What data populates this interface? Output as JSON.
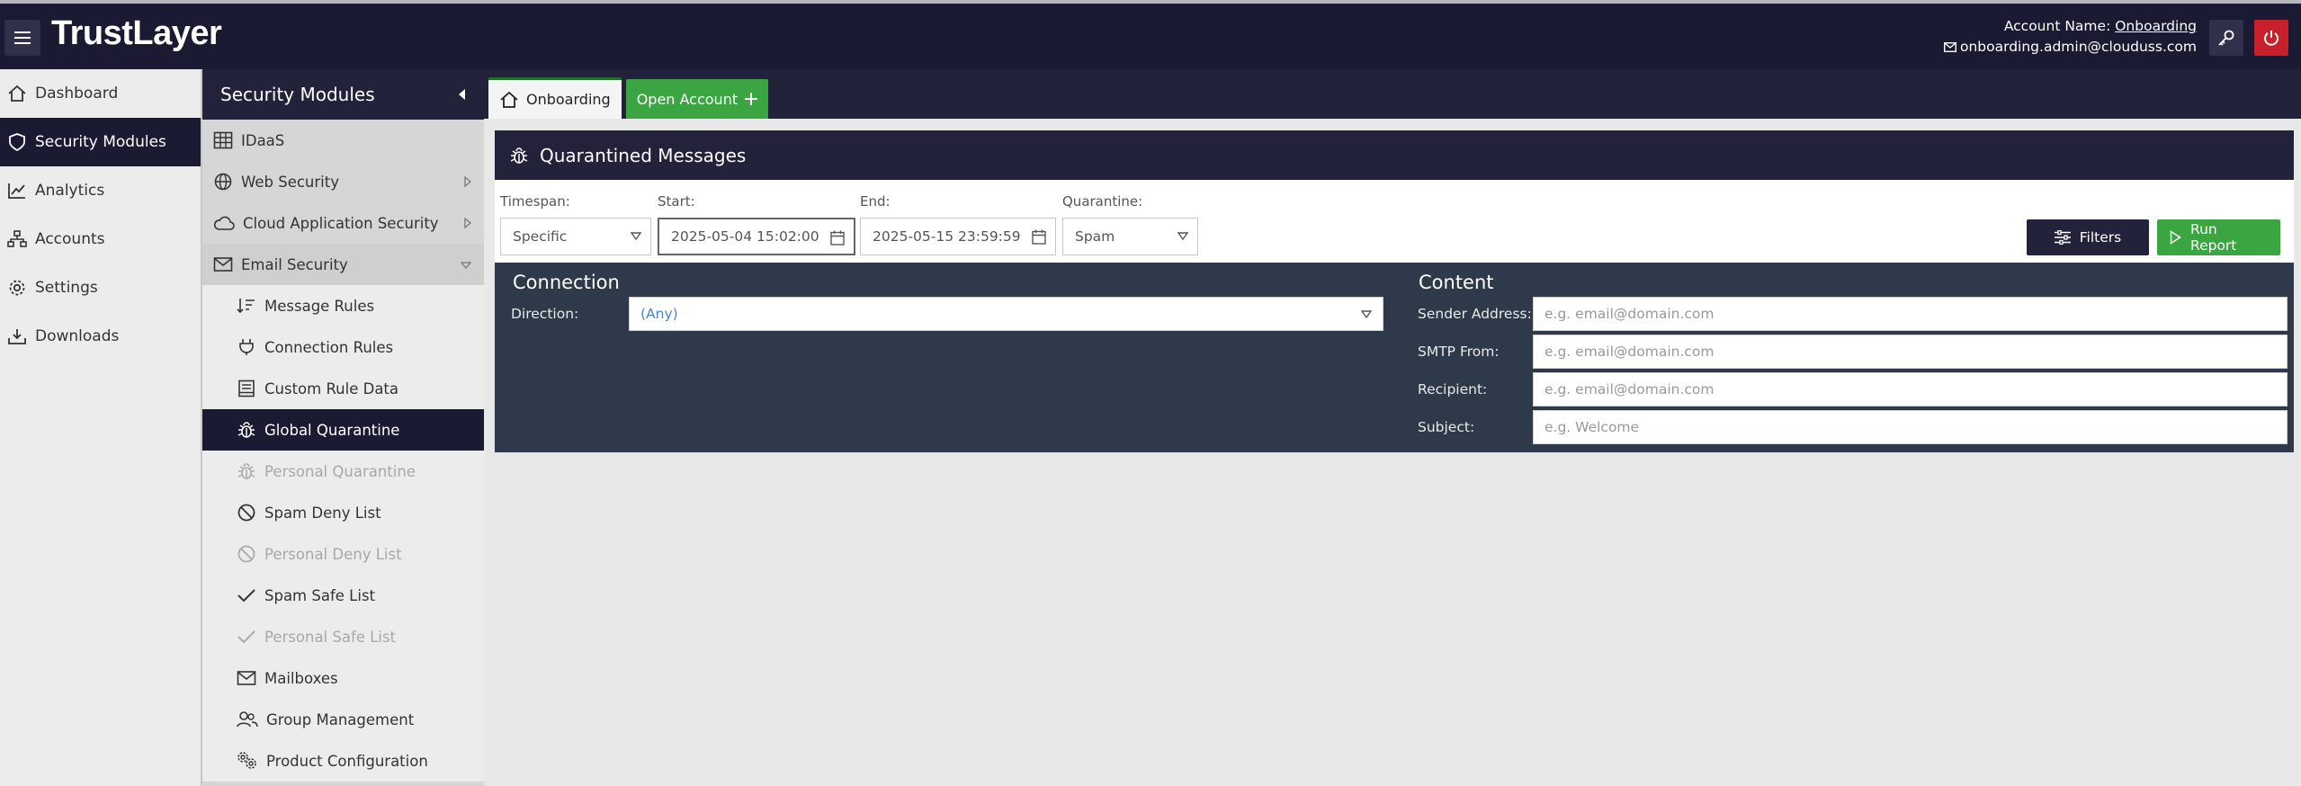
{
  "header": {
    "logo": "TrustLayer",
    "account_label": "Account Name:",
    "account_name": "Onboarding",
    "email": "onboarding.admin@clouduss.com"
  },
  "nav_primary": {
    "items": [
      {
        "label": "Dashboard",
        "icon": "home-icon"
      },
      {
        "label": "Security Modules",
        "icon": "shield-icon",
        "active": true
      },
      {
        "label": "Analytics",
        "icon": "chart-icon"
      },
      {
        "label": "Accounts",
        "icon": "org-chart-icon"
      },
      {
        "label": "Settings",
        "icon": "gear-icon"
      },
      {
        "label": "Downloads",
        "icon": "download-icon"
      }
    ]
  },
  "nav_secondary": {
    "title": "Security Modules",
    "items": [
      {
        "label": "IDaaS",
        "icon": "grid-icon"
      },
      {
        "label": "Web Security",
        "icon": "globe-icon"
      },
      {
        "label": "Cloud Application Security",
        "icon": "cloud-icon"
      },
      {
        "label": "Email Security",
        "icon": "envelope-icon"
      },
      {
        "label": "Message Rules",
        "icon": "sort-list-icon"
      },
      {
        "label": "Connection Rules",
        "icon": "plug-icon"
      },
      {
        "label": "Custom Rule Data",
        "icon": "document-icon"
      },
      {
        "label": "Global Quarantine",
        "icon": "bug-icon"
      },
      {
        "label": "Personal Quarantine",
        "icon": "bug-icon"
      },
      {
        "label": "Spam Deny List",
        "icon": "ban-icon"
      },
      {
        "label": "Personal Deny List",
        "icon": "ban-icon"
      },
      {
        "label": "Spam Safe List",
        "icon": "check-icon"
      },
      {
        "label": "Personal Safe List",
        "icon": "check-icon"
      },
      {
        "label": "Mailboxes",
        "icon": "envelope-icon"
      },
      {
        "label": "Group Management",
        "icon": "users-icon"
      },
      {
        "label": "Product Configuration",
        "icon": "gears-icon"
      }
    ]
  },
  "tabs": {
    "home": "Onboarding",
    "open_account": "Open Account"
  },
  "panel": {
    "title": "Quarantined Messages"
  },
  "filters": {
    "timespan_label": "Timespan:",
    "timespan_value": "Specific",
    "start_label": "Start:",
    "start_value": "2025-05-04 15:02:00",
    "end_label": "End:",
    "end_value": "2025-05-15 23:59:59",
    "quarantine_label": "Quarantine:",
    "quarantine_value": "Spam",
    "filters_button": "Filters",
    "run_button": "Run Report"
  },
  "criteria": {
    "connection_title": "Connection",
    "direction_label": "Direction:",
    "direction_value": "(Any)",
    "content_title": "Content",
    "sender_label": "Sender Address:",
    "sender_placeholder": "e.g. email@domain.com",
    "smtp_label": "SMTP From:",
    "smtp_placeholder": "e.g. email@domain.com",
    "recipient_label": "Recipient:",
    "recipient_placeholder": "e.g. email@domain.com",
    "subject_label": "Subject:",
    "subject_placeholder": "e.g. Welcome"
  },
  "colors": {
    "navy": "#1a1a33",
    "green": "#3aa541",
    "red": "#c8202a",
    "slate": "#2e3a4a"
  }
}
